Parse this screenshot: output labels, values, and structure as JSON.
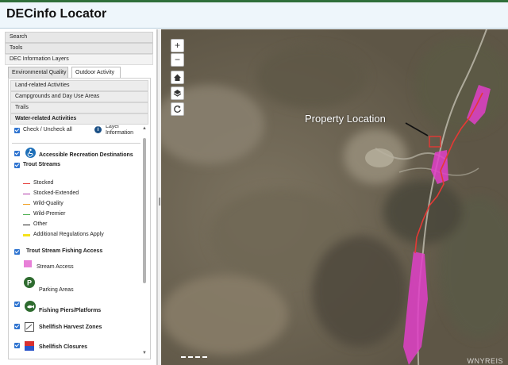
{
  "app": {
    "title": "DECinfo Locator"
  },
  "sidebar": {
    "sections": [
      "Search",
      "Tools",
      "DEC Information Layers"
    ],
    "tabs": [
      "Environmental Quality",
      "Outdoor Activity"
    ],
    "subsections": [
      "Land-related Activities",
      "Campgrounds and Day Use Areas",
      "Trails",
      "Water-related Activities"
    ],
    "check_all": "Check / Uncheck all",
    "layer_info": "Layer\nInformation",
    "layers": {
      "accessible": "Accessible Recreation Destinations",
      "trout_streams": "Trout Streams",
      "trout_legend": [
        {
          "label": "Stocked",
          "color": "#e53935"
        },
        {
          "label": "Stocked-Extended",
          "color": "#b03aa8"
        },
        {
          "label": "Wild-Quality",
          "color": "#f0a020"
        },
        {
          "label": "Wild-Premier",
          "color": "#4caf50"
        },
        {
          "label": "Other",
          "color": "#222222"
        },
        {
          "label": "Additional Regulations Apply",
          "color": "#f5e21b"
        }
      ],
      "fishing_access": "Trout Stream Fishing Access",
      "stream_access": "Stream Access",
      "parking": "Parking Areas",
      "piers": "Fishing Piers/Platforms",
      "shellfish_harvest": "Shellfish Harvest Zones",
      "shellfish_closures": "Shellfish Closures"
    }
  },
  "map": {
    "annotation": "Property Location",
    "watermark": "WNYREIS",
    "controls": [
      "zoom-in",
      "zoom-out",
      "home",
      "layers",
      "refresh"
    ],
    "colors": {
      "stream_access": "#e040c8",
      "stocked_stream": "#e53935"
    }
  }
}
